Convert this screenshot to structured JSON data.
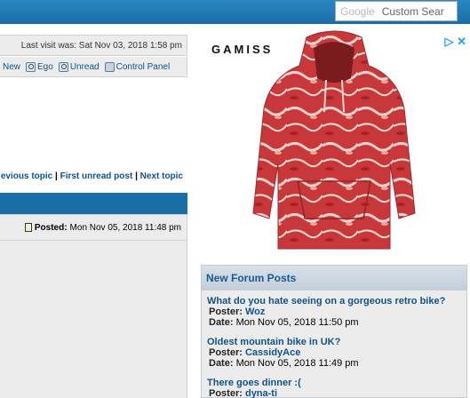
{
  "search": {
    "logo_text": "Google",
    "placeholder": "Custom Sear"
  },
  "forum": {
    "last_visit": "Last visit was: Sat Nov 03, 2018 1:58 pm",
    "links": [
      {
        "label": "New",
        "icon": "none"
      },
      {
        "label": "Ego",
        "icon": "search-icon"
      },
      {
        "label": "Unread",
        "icon": "search-icon"
      },
      {
        "label": "Control Panel",
        "icon": "user-icon"
      }
    ],
    "topic_nav": {
      "prev": "evious topic",
      "first_unread": "First unread post",
      "next": "Next topic",
      "sep": "|"
    },
    "posted_label": "Posted:",
    "posted_date": "Mon Nov 05, 2018 11:48 pm"
  },
  "ad": {
    "brand": "GAMISS",
    "adchoices": "▷ ✕",
    "accent": "#1aa7e8"
  },
  "new_posts": {
    "title": "New Forum Posts",
    "poster_label": "Poster:",
    "date_label": "Date:",
    "items": [
      {
        "title": "What do you hate seeing on a gorgeous retro bike?",
        "poster": "Woz",
        "date": "Mon Nov 05, 2018 11:50 pm"
      },
      {
        "title": "Oldest mountain bike in UK?",
        "poster": "CassidyAce",
        "date": "Mon Nov 05, 2018 11:49 pm"
      },
      {
        "title": "There goes dinner :(",
        "poster": "dyna-ti",
        "date": ""
      }
    ]
  },
  "colors": {
    "header_blue": "#1a6ea8",
    "link": "#105289",
    "panel_bg": "#ececec"
  }
}
